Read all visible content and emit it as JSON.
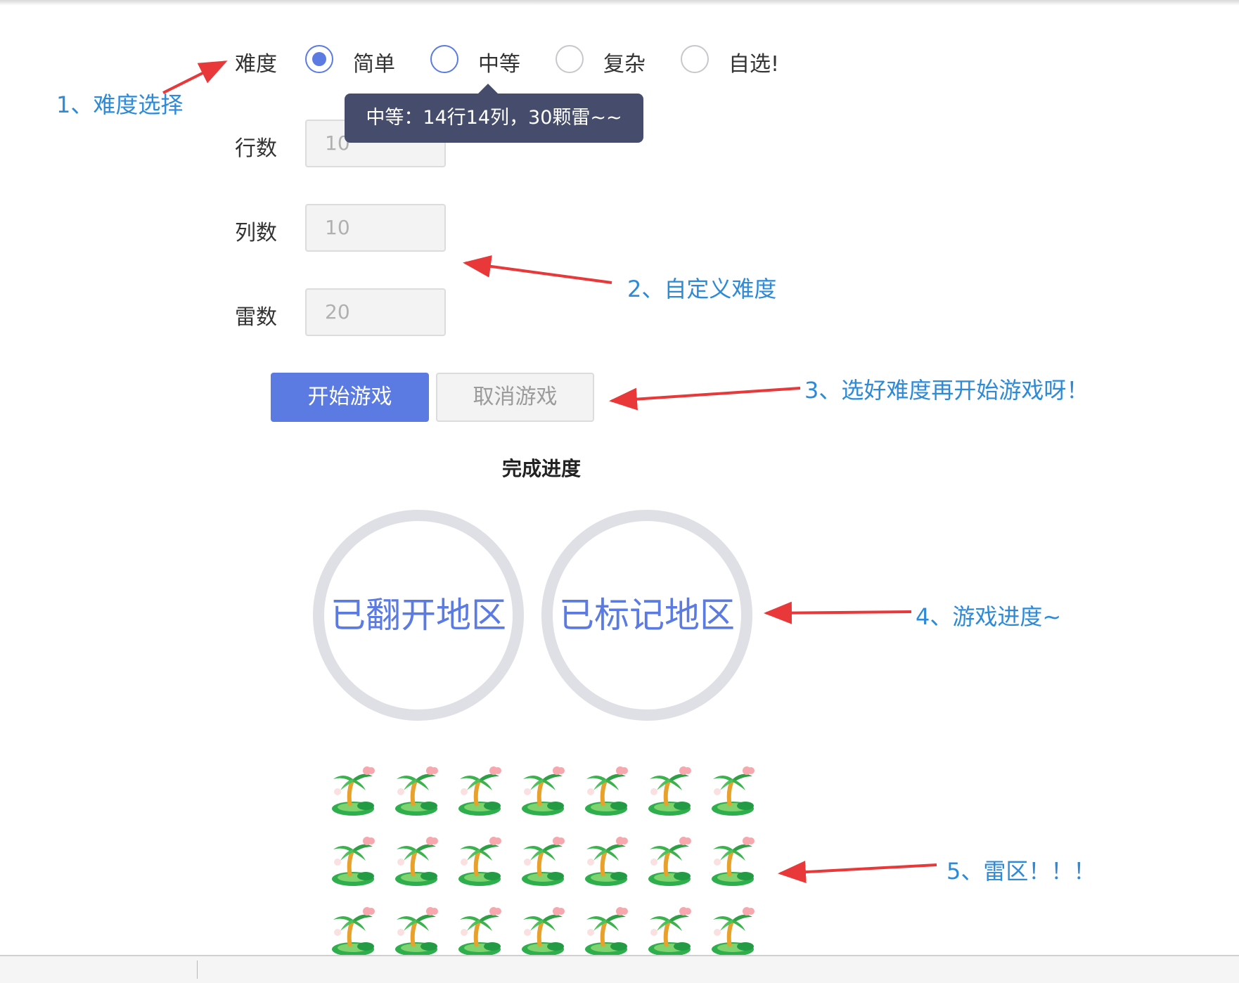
{
  "form": {
    "difficulty_label": "难度",
    "options": [
      {
        "label": "简单",
        "checked": true
      },
      {
        "label": "中等",
        "checked": false
      },
      {
        "label": "复杂",
        "checked": false
      },
      {
        "label": "自选!",
        "checked": false
      }
    ],
    "tooltip": "中等：14行14列，30颗雷~~",
    "rows_label": "行数",
    "rows_value": "10",
    "cols_label": "列数",
    "cols_value": "10",
    "mines_label": "雷数",
    "mines_value": "20",
    "start_button": "开始游戏",
    "cancel_button": "取消游戏"
  },
  "progress": {
    "title": "完成进度",
    "opened_label": "已翻开地区",
    "flagged_label": "已标记地区"
  },
  "annotations": {
    "note1": "1、难度选择",
    "note2": "2、自定义难度",
    "note3": "3、选好难度再开始游戏呀！",
    "note4": "4、游戏进度~",
    "note5": "5、雷区！！！",
    "arrow_color": "#e8383a",
    "text_color": "#2d8ad8"
  },
  "minefield": {
    "rows_visible": 3,
    "cols_visible": 7,
    "cell_icon": "palm-island-icon"
  },
  "colors": {
    "accent": "#5b7be3",
    "tooltip_bg": "#464c6b",
    "ring": "#dfe0e6"
  }
}
